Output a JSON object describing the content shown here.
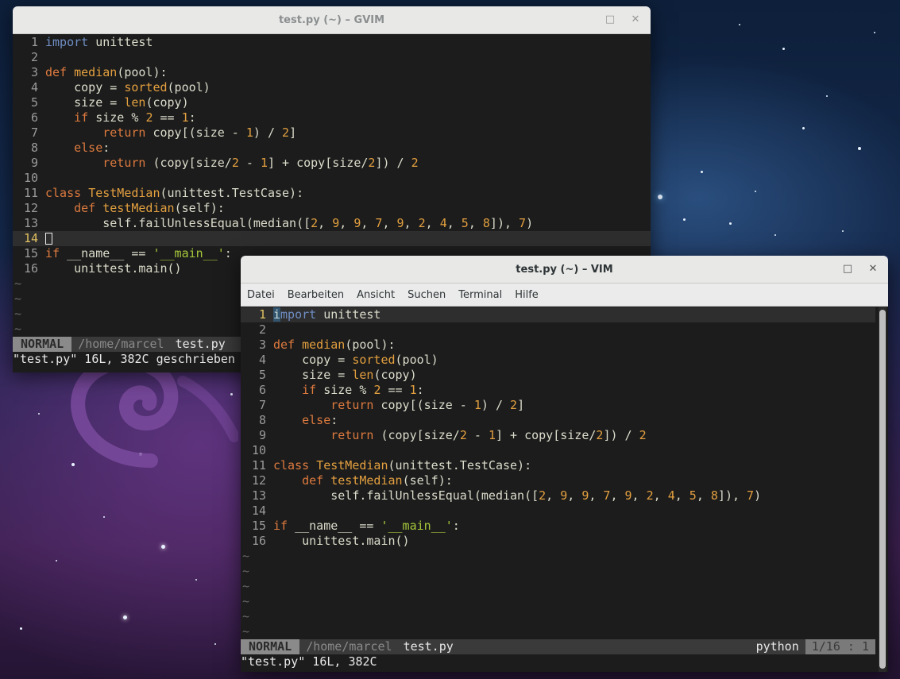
{
  "gvim": {
    "title": "test.py (~) – GVIM",
    "status": {
      "mode": "NORMAL",
      "path": "/home/marcel",
      "file": "test.py"
    },
    "message": "\"test.py\" 16L, 382C geschrieben"
  },
  "vim": {
    "title": "test.py (~) – VIM",
    "menu": [
      "Datei",
      "Bearbeiten",
      "Ansicht",
      "Suchen",
      "Terminal",
      "Hilfe"
    ],
    "status": {
      "mode": "NORMAL",
      "path": "/home/marcel",
      "file": "test.py",
      "filetype": "python",
      "position": "1/16 : 1"
    },
    "message": "\"test.py\" 16L, 382C"
  },
  "code": [
    {
      "n": "1",
      "t": "import unittest"
    },
    {
      "n": "2",
      "t": ""
    },
    {
      "n": "3",
      "t": "def median(pool):"
    },
    {
      "n": "4",
      "t": "    copy = sorted(pool)"
    },
    {
      "n": "5",
      "t": "    size = len(copy)"
    },
    {
      "n": "6",
      "t": "    if size % 2 == 1:"
    },
    {
      "n": "7",
      "t": "        return copy[(size - 1) / 2]"
    },
    {
      "n": "8",
      "t": "    else:"
    },
    {
      "n": "9",
      "t": "        return (copy[size/2 - 1] + copy[size/2]) / 2"
    },
    {
      "n": "10",
      "t": ""
    },
    {
      "n": "11",
      "t": "class TestMedian(unittest.TestCase):"
    },
    {
      "n": "12",
      "t": "    def testMedian(self):"
    },
    {
      "n": "13",
      "t": "        self.failUnlessEqual(median([2, 9, 9, 7, 9, 2, 4, 5, 8]), 7)"
    },
    {
      "n": "14",
      "t": ""
    },
    {
      "n": "15",
      "t": "if __name__ == '__main__':"
    },
    {
      "n": "16",
      "t": "    unittest.main()"
    }
  ],
  "tilde": "~",
  "buttons": {
    "maximize": "□",
    "close": "✕"
  }
}
